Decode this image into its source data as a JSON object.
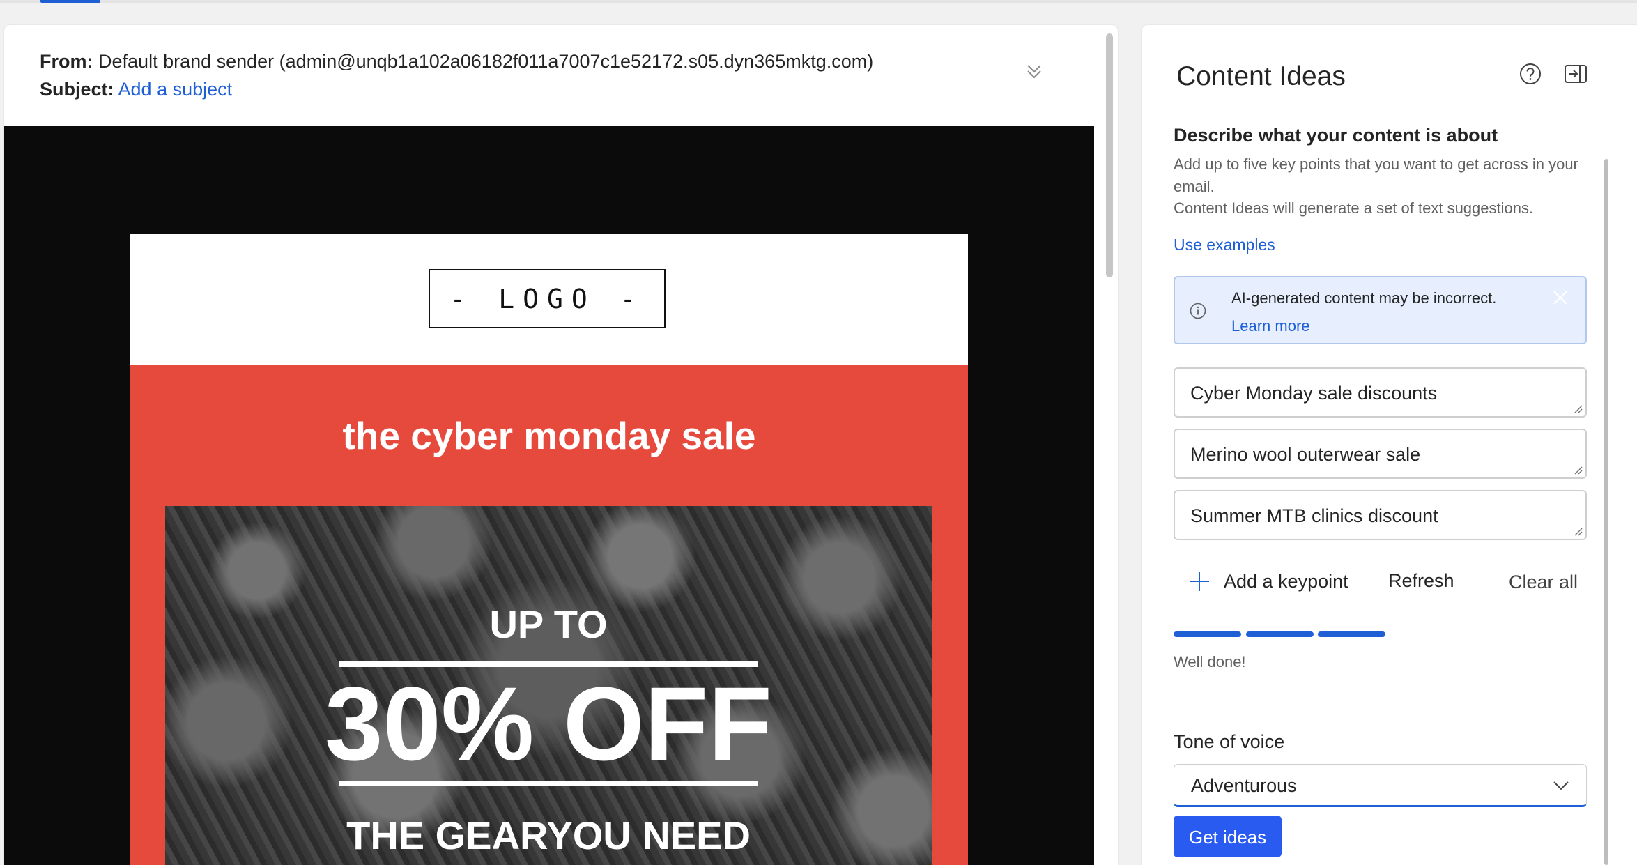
{
  "email_header": {
    "from_label": "From:",
    "from_value": "Default brand sender (admin@unqb1a102a06182f011a7007c1e52172.s05.dyn365mktg.com)",
    "subject_label": "Subject:",
    "subject_value": "Add a subject"
  },
  "email_body": {
    "logo_text": "- LOGO -",
    "sale_title": "the cyber monday sale",
    "hero_up_to": "UP TO",
    "hero_discount": "30% OFF",
    "hero_tagline": "THE GEARYOU NEED"
  },
  "panel": {
    "title": "Content Ideas",
    "section_title": "Describe what your content is about",
    "section_desc_line1": "Add up to five key points that you want to get across in your email.",
    "section_desc_line2": "Content Ideas will generate a set of text suggestions.",
    "use_examples": "Use examples",
    "notice": {
      "text": "AI-generated content may be incorrect.",
      "link": "Learn more"
    },
    "keypoints": [
      "Cyber Monday sale discounts",
      "Merino wool outerwear sale",
      "Summer MTB clinics discount"
    ],
    "actions": {
      "add_keypoint": "Add a keypoint",
      "refresh": "Refresh",
      "clear_all": "Clear all"
    },
    "progress_steps_filled": 3,
    "progress_message": "Well done!",
    "tone_label": "Tone of voice",
    "tone_value": "Adventurous",
    "get_ideas": "Get ideas"
  },
  "colors": {
    "accent": "#1f5fd6",
    "primary_button": "#2a5bf0",
    "banner_red": "#e64a3c",
    "notice_bg": "#e7efff"
  },
  "icons": [
    "collapse-icon",
    "help-icon",
    "dock-panel-icon",
    "info-icon",
    "dismiss-icon",
    "plus-icon",
    "chevron-down-icon"
  ]
}
